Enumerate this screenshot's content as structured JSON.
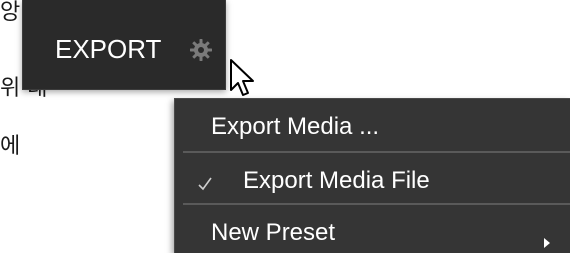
{
  "background": {
    "text_fragments": [
      "앙",
      "위 대",
      "에"
    ]
  },
  "toolbar": {
    "export_label": "EXPORT",
    "settings_icon": "gear-icon",
    "cursor_icon": "mouse-pointer-icon"
  },
  "menu": {
    "items": [
      {
        "label": "Export Media ...",
        "checked": false,
        "has_submenu": false
      },
      {
        "label": "Export Media File",
        "checked": true,
        "has_submenu": false
      },
      {
        "label": "New Preset",
        "checked": false,
        "has_submenu": true
      }
    ],
    "check_icon": "checkmark-icon",
    "submenu_icon": "chevron-right-icon"
  },
  "colors": {
    "button_bg": "#2a2a2a",
    "menu_bg": "#353535",
    "menu_text": "#ffffff",
    "separator": "#5a5a5a",
    "gear": "#7a7a7a"
  }
}
